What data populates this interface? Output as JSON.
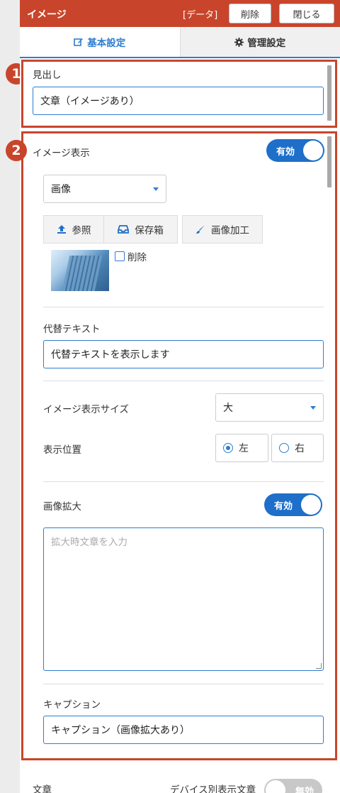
{
  "header": {
    "title": "イメージ",
    "data_tag": "[データ]",
    "delete_label": "削除",
    "close_label": "閉じる"
  },
  "tabs": [
    {
      "label": "基本設定",
      "icon": "edit-icon",
      "active": true
    },
    {
      "label": "管理設定",
      "icon": "gear-icon",
      "active": false
    }
  ],
  "callouts": {
    "one": "1",
    "two": "2"
  },
  "heading_section": {
    "label": "見出し",
    "value": "文章（イメージあり）"
  },
  "image_section": {
    "label": "イメージ表示",
    "toggle": "有効",
    "source_select": "画像",
    "buttons": {
      "upload": "参照",
      "storage": "保存箱",
      "edit": "画像加工"
    },
    "delete_check_label": "削除",
    "alt_label": "代替テキスト",
    "alt_value": "代替テキストを表示します",
    "size_label": "イメージ表示サイズ",
    "size_value": "大",
    "position_label": "表示位置",
    "position_left": "左",
    "position_right": "右",
    "zoom_label": "画像拡大",
    "zoom_toggle": "有効",
    "zoom_placeholder": "拡大時文章を入力",
    "caption_label": "キャプション",
    "caption_value": "キャプション（画像拡大あり）"
  },
  "footer_peek": {
    "text_label": "文章",
    "device_label": "デバイス別表示文章",
    "device_toggle": "無効"
  },
  "colors": {
    "accent": "#c8452b",
    "primary": "#2e7dd1",
    "toggle_on": "#1d6fc9"
  }
}
